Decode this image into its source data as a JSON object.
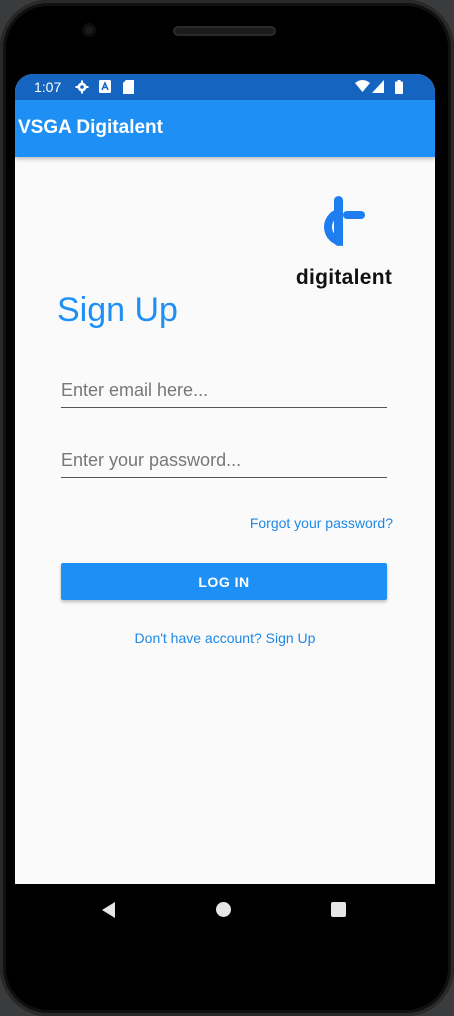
{
  "status_bar": {
    "time": "1:07",
    "icons": [
      "gear-icon",
      "a-icon",
      "sd-card-icon",
      "wifi-icon",
      "signal-icon",
      "battery-icon"
    ]
  },
  "app_bar": {
    "title": "VSGA Digitalent"
  },
  "logo": {
    "text": "digitalent",
    "color": "#1e7ef0"
  },
  "form": {
    "heading": "Sign Up",
    "email_placeholder": "Enter email here...",
    "email_value": "",
    "password_placeholder": "Enter your password...",
    "password_value": "",
    "forgot_link": "Forgot your password?",
    "login_button": "LOG IN",
    "signup_link": "Don't have account? Sign Up"
  },
  "nav": {
    "icons": [
      "back-icon",
      "home-icon",
      "recents-icon"
    ]
  },
  "colors": {
    "accent": "#1e90f5",
    "status_bar": "#1565c0",
    "background": "#fafafa"
  }
}
